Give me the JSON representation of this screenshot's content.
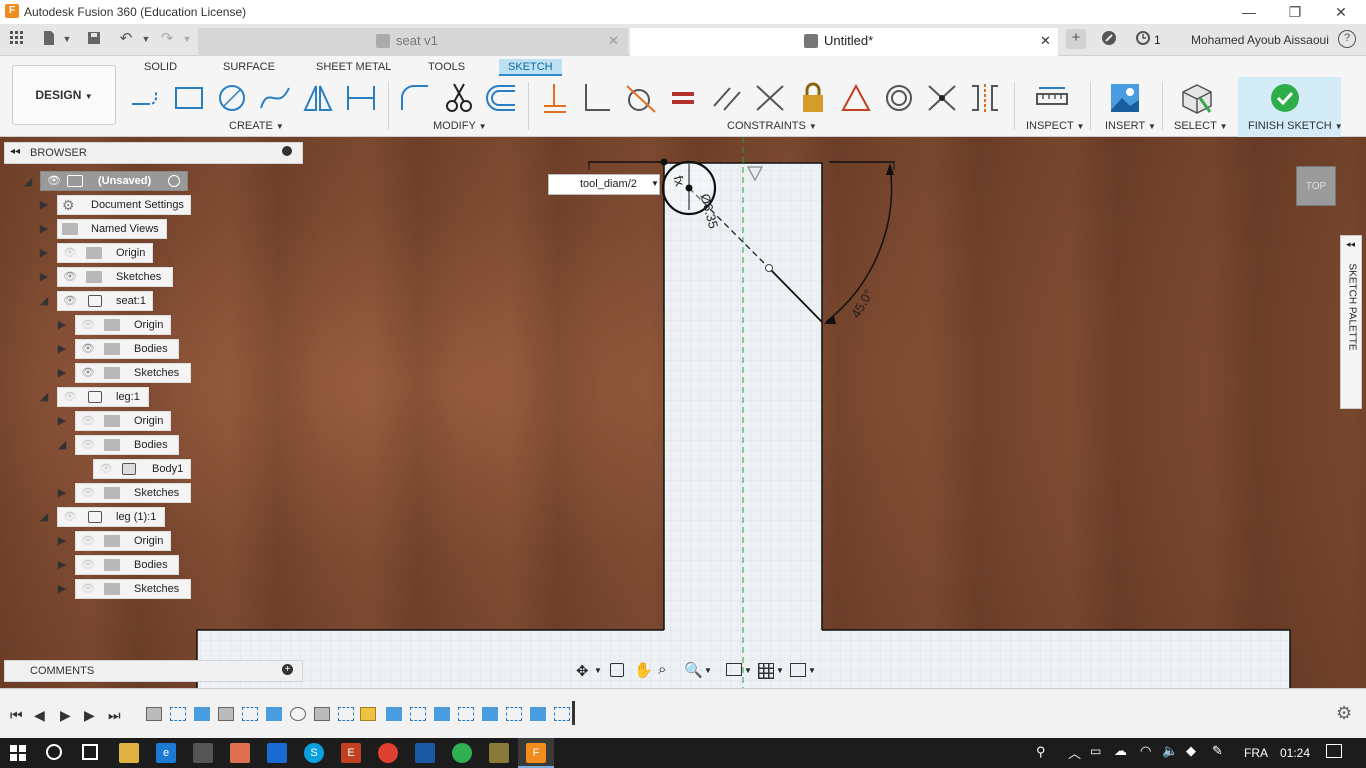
{
  "window": {
    "title": "Autodesk Fusion 360 (Education License)",
    "logo_letter": "F",
    "minimize_label": "—",
    "maximize_label": "❐",
    "close_label": "✕"
  },
  "tabs": {
    "doc1": "seat v1",
    "doc2": "Untitled*",
    "job_count": "1",
    "user": "Mohamed Ayoub Aissaoui",
    "help_label": "?"
  },
  "toolbar": {
    "design": "DESIGN",
    "workspace_tabs": [
      "SOLID",
      "SURFACE",
      "SHEET METAL",
      "TOOLS",
      "SKETCH"
    ],
    "groups": {
      "create": "CREATE",
      "modify": "MODIFY",
      "constraints": "CONSTRAINTS",
      "inspect": "INSPECT",
      "insert": "INSERT",
      "select": "SELECT",
      "finish": "FINISH SKETCH"
    }
  },
  "browser": {
    "title": "BROWSER",
    "nodes": [
      {
        "label": "(Unsaved)"
      },
      {
        "label": "Document Settings"
      },
      {
        "label": "Named Views"
      },
      {
        "label": "Origin"
      },
      {
        "label": "Sketches"
      },
      {
        "label": "seat:1"
      },
      {
        "label": "Origin"
      },
      {
        "label": "Bodies"
      },
      {
        "label": "Sketches"
      },
      {
        "label": "leg:1"
      },
      {
        "label": "Origin"
      },
      {
        "label": "Bodies"
      },
      {
        "label": "Body1"
      },
      {
        "label": "Sketches"
      },
      {
        "label": "leg (1):1"
      },
      {
        "label": "Origin"
      },
      {
        "label": "Bodies"
      },
      {
        "label": "Sketches"
      }
    ]
  },
  "comments": {
    "title": "COMMENTS"
  },
  "sketch": {
    "dimension_input": "tool_diam/2",
    "diameter_label": "Ø6.35",
    "angle_label": "45.0°",
    "fx_label": "fx"
  },
  "viewcube": {
    "label": "TOP"
  },
  "palette": {
    "label": "SKETCH PALETTE"
  },
  "taskbar": {
    "lang": "FRA",
    "time": "01:24"
  }
}
